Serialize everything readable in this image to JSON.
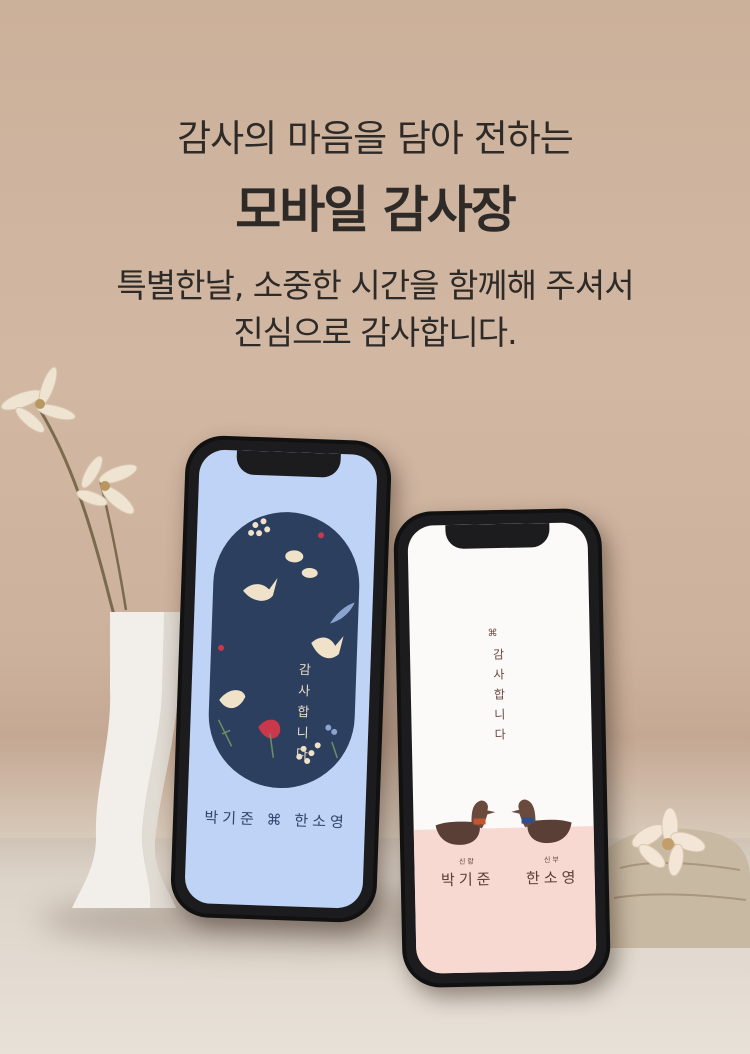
{
  "headline": {
    "line1": "감사의 마음을 담아 전하는",
    "line2": "모바일 감사장"
  },
  "description": {
    "line1": "특별한날, 소중한 시간을 함께해 주셔서",
    "line2": "진심으로 감사합니다."
  },
  "phone_left": {
    "message": "감사합니다",
    "names": "박기준 ⌘ 한소영",
    "colors": {
      "screen": "#bfd3f6",
      "oval": "#2d3f5e",
      "text": "#31456c"
    }
  },
  "phone_right": {
    "mark": "⌘",
    "message": "감사합니다",
    "groom_role": "신랑",
    "groom_name": "박기준",
    "bride_role": "신부",
    "bride_name": "한소영",
    "colors": {
      "screen": "#fbfaf8",
      "bottom": "#f8d9d2",
      "text": "#5a3d36"
    }
  },
  "icons": [
    "vase-icon",
    "dried-flower-icon",
    "rock-icon",
    "wooden-duck-icon",
    "dove-icon",
    "leaf-icon"
  ]
}
